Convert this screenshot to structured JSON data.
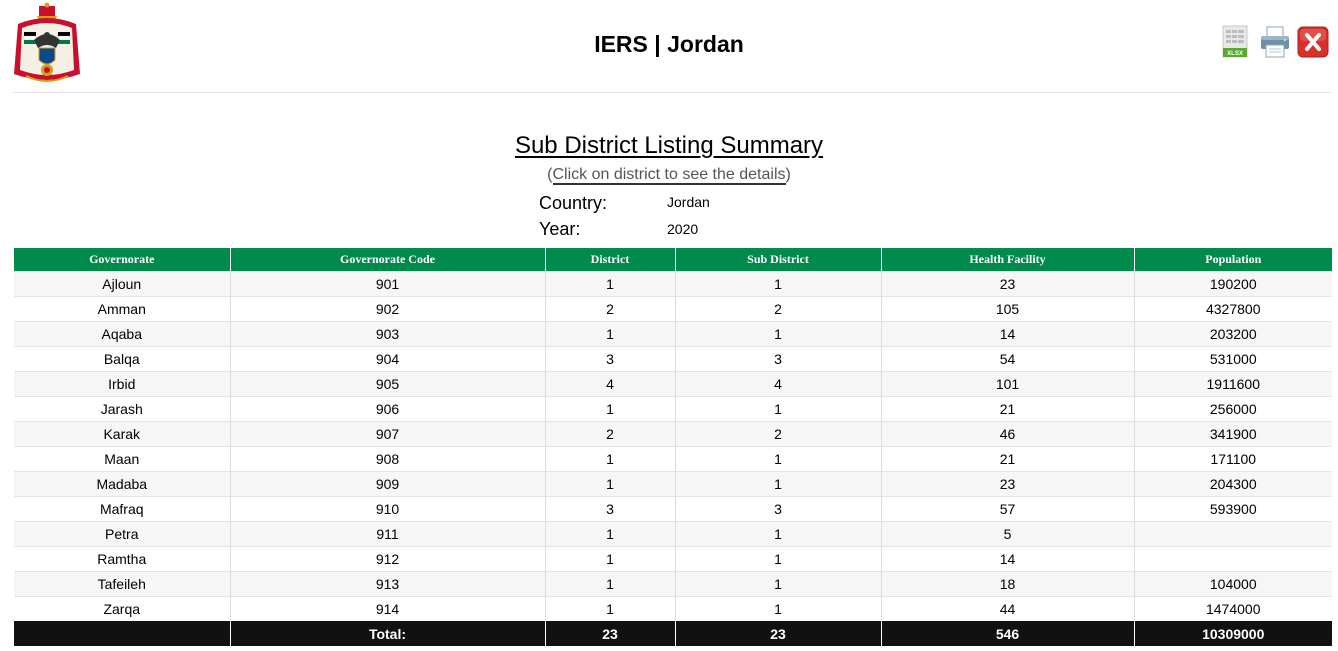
{
  "header": {
    "app_title": "IERS | Jordan",
    "logo_icon": "jordan-coat-of-arms-icon",
    "toolbar": [
      {
        "name": "export-xlsx-button",
        "icon": "xlsx-file-icon",
        "label": "XLSX"
      },
      {
        "name": "print-button",
        "icon": "printer-icon"
      },
      {
        "name": "close-button",
        "icon": "close-icon"
      }
    ]
  },
  "report": {
    "title": "Sub District Listing Summary",
    "subtitle_open": "(",
    "subtitle_link": "Click on district to see the details",
    "subtitle_close": ")",
    "country_label": "Country:",
    "country_value": "Jordan",
    "year_label": "Year:",
    "year_value": "2020"
  },
  "table": {
    "columns": [
      "Governorate",
      "Governorate Code",
      "District",
      "Sub District",
      "Health Facility",
      "Population"
    ],
    "rows": [
      [
        "Ajloun",
        "901",
        "1",
        "1",
        "23",
        "190200"
      ],
      [
        "Amman",
        "902",
        "2",
        "2",
        "105",
        "4327800"
      ],
      [
        "Aqaba",
        "903",
        "1",
        "1",
        "14",
        "203200"
      ],
      [
        "Balqa",
        "904",
        "3",
        "3",
        "54",
        "531000"
      ],
      [
        "Irbid",
        "905",
        "4",
        "4",
        "101",
        "1911600"
      ],
      [
        "Jarash",
        "906",
        "1",
        "1",
        "21",
        "256000"
      ],
      [
        "Karak",
        "907",
        "2",
        "2",
        "46",
        "341900"
      ],
      [
        "Maan",
        "908",
        "1",
        "1",
        "21",
        "171100"
      ],
      [
        "Madaba",
        "909",
        "1",
        "1",
        "23",
        "204300"
      ],
      [
        "Mafraq",
        "910",
        "3",
        "3",
        "57",
        "593900"
      ],
      [
        "Petra",
        "911",
        "1",
        "1",
        "5",
        ""
      ],
      [
        "Ramtha",
        "912",
        "1",
        "1",
        "14",
        ""
      ],
      [
        "Tafeileh",
        "913",
        "1",
        "1",
        "18",
        "104000"
      ],
      [
        "Zarqa",
        "914",
        "1",
        "1",
        "44",
        "1474000"
      ]
    ],
    "totals": [
      "",
      "Total:",
      "23",
      "23",
      "546",
      "10309000"
    ]
  },
  "colors": {
    "header_green": "#008a4b",
    "footer_black": "#111111",
    "close_red": "#d9302c"
  }
}
